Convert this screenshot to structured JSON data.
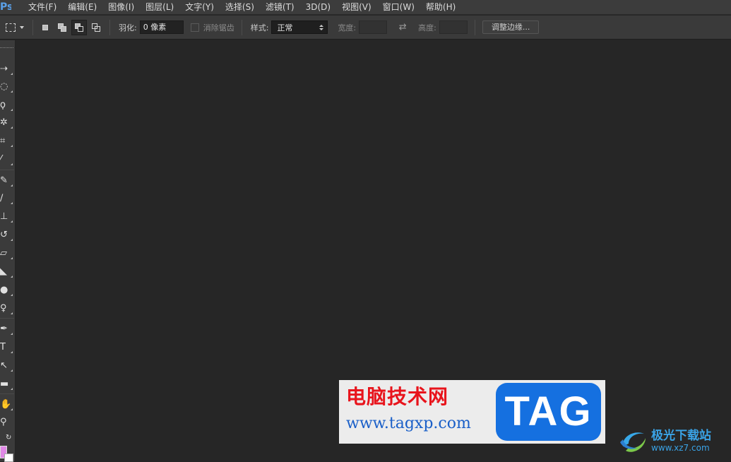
{
  "menubar": {
    "logo": "Ps",
    "items": [
      {
        "label": "文件(F)"
      },
      {
        "label": "编辑(E)"
      },
      {
        "label": "图像(I)"
      },
      {
        "label": "图层(L)"
      },
      {
        "label": "文字(Y)"
      },
      {
        "label": "选择(S)"
      },
      {
        "label": "滤镜(T)"
      },
      {
        "label": "3D(D)"
      },
      {
        "label": "视图(V)"
      },
      {
        "label": "窗口(W)"
      },
      {
        "label": "帮助(H)"
      }
    ]
  },
  "options": {
    "feather_label": "羽化:",
    "feather_value": "0 像素",
    "antialias_label": "消除锯齿",
    "style_label": "样式:",
    "style_value": "正常",
    "width_label": "宽度:",
    "width_value": "",
    "height_label": "高度:",
    "height_value": "",
    "refine_edge_label": "调整边缘..."
  },
  "toolbox": {
    "fg_color": "#e088e6",
    "bg_color": "#ffffff"
  },
  "watermarks": {
    "main_cn": "电脑技术网",
    "main_url": "www.tagxp.com",
    "main_tag": "TAG",
    "side_name": "极光下载站",
    "side_url": "www.xz7.com"
  }
}
